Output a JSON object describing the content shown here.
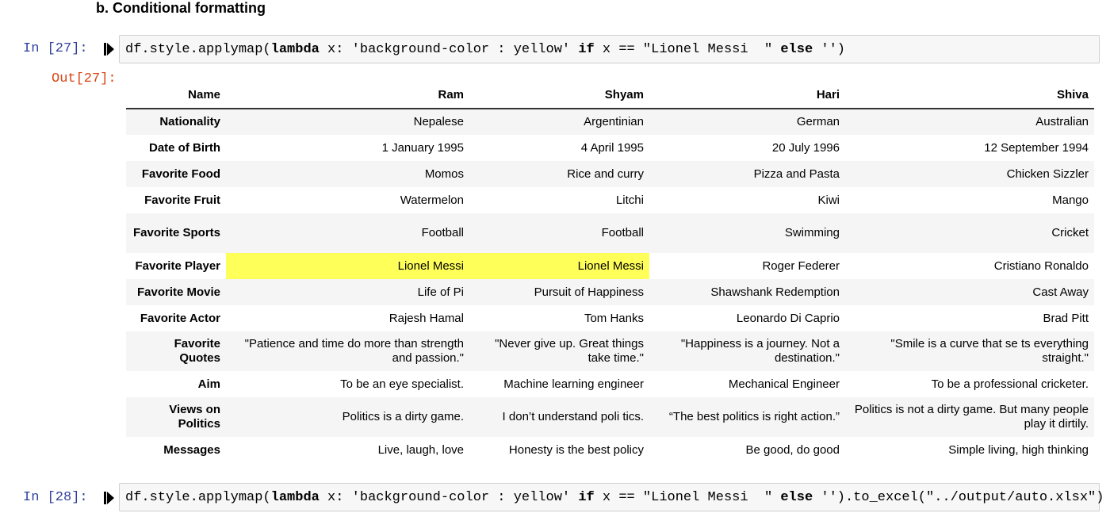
{
  "heading": "b. Conditional formatting",
  "cells": [
    {
      "prompt": "In [27]:",
      "code": {
        "p1": "df.style.applymap(",
        "k1": "lambda",
        "p2": " x: 'background-color : yellow' ",
        "k2": "if",
        "p3": " x == \"Lionel Messi  \" ",
        "k3": "else",
        "p4": " '')"
      },
      "out_prompt": "Out[27]:"
    },
    {
      "prompt": "In [28]:",
      "code": {
        "p1": "df.style.applymap(",
        "k1": "lambda",
        "p2": " x: 'background-color : yellow' ",
        "k2": "if",
        "p3": " x == \"Lionel Messi  \" ",
        "k3": "else",
        "p4": " '').to_excel(\"../output/auto.xlsx\")"
      }
    }
  ],
  "table": {
    "columns": [
      "Name",
      "Ram",
      "Shyam",
      "Hari",
      "Shiva"
    ],
    "highlight_color": "#ffff5a",
    "rows": [
      {
        "label": "Nationality",
        "values": [
          "Nepalese",
          "Argentinian",
          "German",
          "Australian"
        ]
      },
      {
        "label": "Date of Birth",
        "values": [
          "1 January 1995",
          "4 April 1995",
          "20 July 1996",
          "12 September 1994"
        ]
      },
      {
        "label": "Favorite Food",
        "values": [
          "Momos",
          "Rice and curry",
          "Pizza and Pasta",
          "Chicken Sizzler"
        ]
      },
      {
        "label": "Favorite Fruit",
        "values": [
          "Watermelon",
          "Litchi",
          "Kiwi",
          "Mango"
        ]
      },
      {
        "label": "Favorite Sports",
        "values": [
          "Football",
          "Football",
          "Swimming",
          "Cricket"
        ]
      },
      {
        "label": "Favorite Player",
        "values": [
          "Lionel Messi",
          "Lionel Messi",
          "Roger Federer",
          "Cristiano Ronaldo"
        ]
      },
      {
        "label": "Favorite Movie",
        "values": [
          "Life of Pi",
          "Pursuit of Happiness",
          "Shawshank Redemption",
          "Cast Away"
        ]
      },
      {
        "label": "Favorite Actor",
        "values": [
          "Rajesh Hamal",
          "Tom Hanks",
          "Leonardo Di Caprio",
          "Brad Pitt"
        ]
      },
      {
        "label": "Favorite Quotes",
        "values": [
          "\"Patience and time do more than strength and passion.\"",
          "\"Never give up. Great things take time.\"",
          "\"Happiness is a journey. Not a destination.\"",
          "\"Smile is a curve that se ts everything straight.\""
        ]
      },
      {
        "label": "Aim",
        "values": [
          "To be an eye specialist.",
          "Machine learning engineer",
          "Mechanical Engineer",
          "To be a professional cricketer."
        ]
      },
      {
        "label": "Views on Politics",
        "values": [
          "Politics is a dirty game.",
          "I don’t understand poli tics.",
          "“The best politics is right action.”",
          "Politics is not a dirty game. But many people play it dirtily."
        ]
      },
      {
        "label": "Messages",
        "values": [
          "Live, laugh, love",
          "Honesty is the best policy",
          "Be good, do good",
          "Simple living, high thinking"
        ]
      }
    ]
  }
}
